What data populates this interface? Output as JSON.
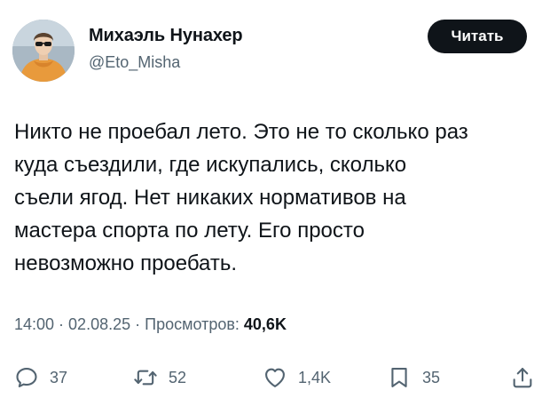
{
  "author": {
    "name": "Михаэль Нунахер",
    "handle": "@Eto_Misha",
    "avatar_icon": "profile-photo"
  },
  "follow_button": {
    "label": "Читать"
  },
  "tweet": {
    "text": "Никто не проебал лето. Это не то сколько раз\nкуда съездили, где искупались, сколько\nсъели ягод. Нет никаких нормативов на\nмастера спорта по лету. Его просто\nневозможно проебать."
  },
  "meta": {
    "time": "14:00",
    "sep1": " · ",
    "date": "02.08.25",
    "sep2": " · ",
    "views_label": "Просмотров: ",
    "views_count": "40,6K"
  },
  "actions": {
    "replies": {
      "icon": "reply-icon",
      "count": "37"
    },
    "retweets": {
      "icon": "retweet-icon",
      "count": "52"
    },
    "likes": {
      "icon": "heart-icon",
      "count": "1,4K"
    },
    "bookmarks": {
      "icon": "bookmark-icon",
      "count": "35"
    },
    "share": {
      "icon": "share-icon"
    }
  },
  "colors": {
    "text": "#0f1419",
    "secondary": "#536471",
    "button_bg": "#0f1419",
    "button_text": "#ffffff",
    "background": "#ffffff"
  }
}
